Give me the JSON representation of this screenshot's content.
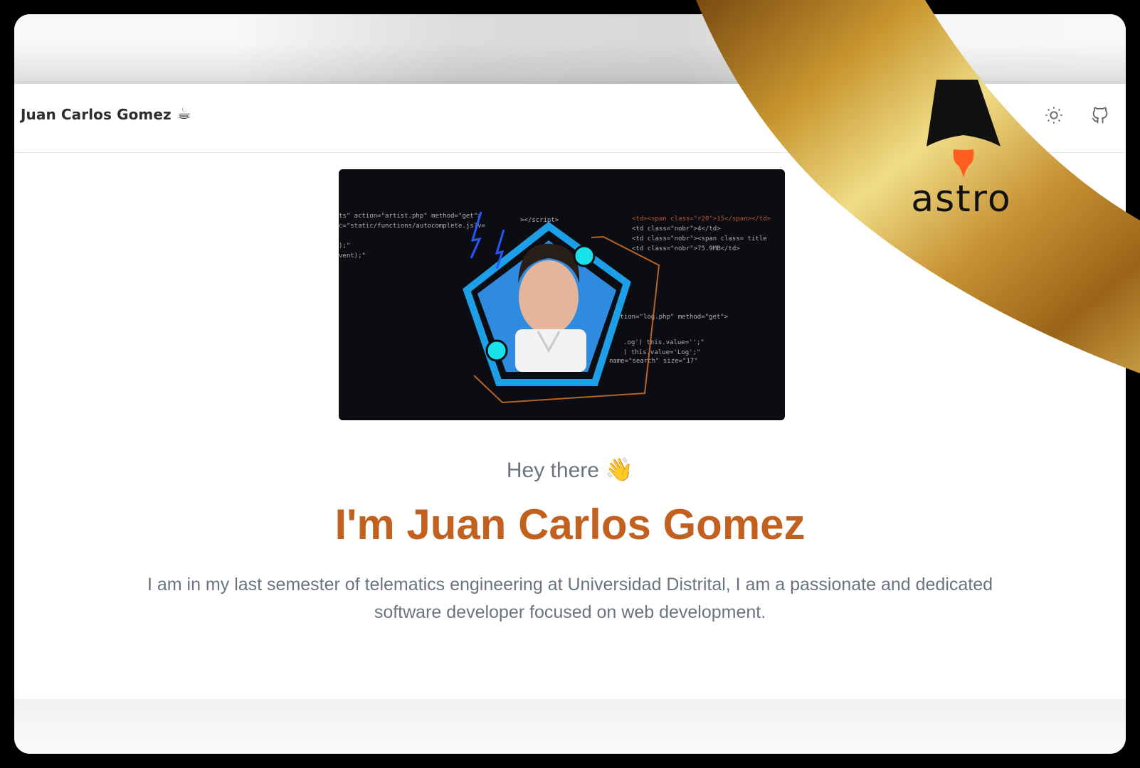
{
  "navbar": {
    "brand": "Juan Carlos Gomez",
    "brand_emoji": "☕",
    "icons": [
      "sun-icon",
      "github-icon"
    ]
  },
  "hero": {
    "image_alt": "avatar-illustration",
    "greeting": "Hey there",
    "greeting_emoji": "👋",
    "title": "I'm Juan Carlos Gomez",
    "description": "I am in my last semester of telematics engineering at Universidad Distrital, I am a passionate and dedicated software developer focused on web development."
  },
  "banner": {
    "logo_text": "astro"
  },
  "colors": {
    "accent": "#c2611f",
    "text_muted": "#6b7280",
    "ribbon_gold": "#c9a24a"
  }
}
